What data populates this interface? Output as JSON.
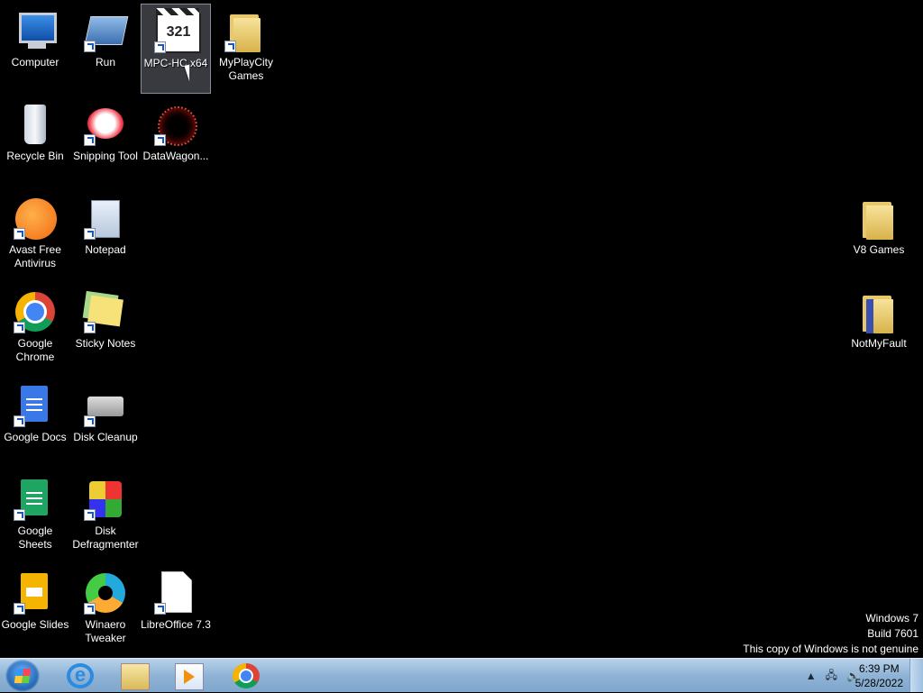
{
  "desktop": {
    "icons": [
      {
        "label": "Computer"
      },
      {
        "label": "Run"
      },
      {
        "label": "MPC-HC x64"
      },
      {
        "label": "MyPlayCity Games"
      },
      {
        "label": "Recycle Bin"
      },
      {
        "label": "Snipping Tool"
      },
      {
        "label": "DataWagon..."
      },
      {
        "label": "Avast Free Antivirus"
      },
      {
        "label": "Notepad"
      },
      {
        "label": "V8 Games"
      },
      {
        "label": "Google Chrome"
      },
      {
        "label": "Sticky Notes"
      },
      {
        "label": "NotMyFault"
      },
      {
        "label": "Google Docs"
      },
      {
        "label": "Disk Cleanup"
      },
      {
        "label": "Google Sheets"
      },
      {
        "label": "Disk Defragmenter"
      },
      {
        "label": "Google Slides"
      },
      {
        "label": "Winaero Tweaker"
      },
      {
        "label": "LibreOffice 7.3"
      }
    ],
    "mpc_glyph": "321"
  },
  "watermark": {
    "line1": "Windows 7",
    "line2": "Build 7601",
    "line3": "This copy of Windows is not genuine"
  },
  "taskbar": {
    "ie_glyph": "e",
    "tray_arrow": "▲",
    "network_glyph": "🖧",
    "volume_glyph": "🔊",
    "time": "6:39 PM",
    "date": "5/28/2022"
  }
}
